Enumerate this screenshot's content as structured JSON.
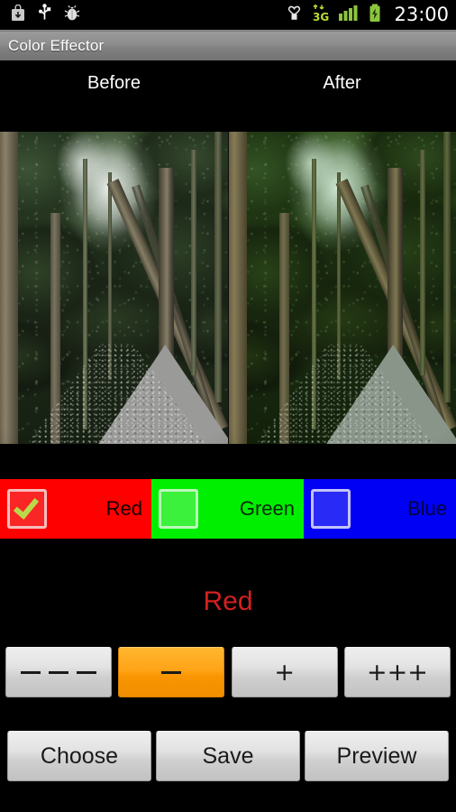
{
  "statusbar": {
    "icons_left": [
      {
        "name": "download-icon",
        "glyph": "⤓"
      },
      {
        "name": "usb-icon",
        "glyph": "ψ"
      },
      {
        "name": "adb-debug-icon",
        "glyph": "🐞"
      }
    ],
    "icons_right": [
      {
        "name": "alarm-or-vibrate-icon",
        "glyph": "♡"
      },
      {
        "name": "network-3g-icon",
        "label": "3G"
      },
      {
        "name": "signal-bars-icon",
        "bars": 4
      },
      {
        "name": "battery-charging-icon",
        "glyph": "⚡"
      }
    ],
    "clock": "23:00"
  },
  "titlebar": {
    "title": "Color Effector"
  },
  "preview": {
    "before_label": "Before",
    "after_label": "After",
    "before_alt": "forest path photo, original",
    "after_alt": "forest path photo, green tinted"
  },
  "channels": [
    {
      "name": "red",
      "label": "Red",
      "checked": true,
      "color": "#ff0000",
      "text_color": "#120000"
    },
    {
      "name": "green",
      "label": "Green",
      "checked": false,
      "color": "#00ee00",
      "text_color": "#062906"
    },
    {
      "name": "blue",
      "label": "Blue",
      "checked": false,
      "color": "#0000f5",
      "text_color": "#04043a"
    }
  ],
  "current_channel": {
    "label": "Red",
    "color": "#d42020"
  },
  "adjust_buttons": [
    {
      "name": "decrease-large",
      "label": "– – –",
      "glyph": "dashes3",
      "active": false
    },
    {
      "name": "decrease-small",
      "label": "–",
      "glyph": "dash1",
      "active": true
    },
    {
      "name": "increase-small",
      "label": "+",
      "glyph": "plus1",
      "active": false
    },
    {
      "name": "increase-large",
      "label": "+++",
      "glyph": "plus3",
      "active": false
    }
  ],
  "actions": [
    {
      "name": "choose",
      "label": "Choose"
    },
    {
      "name": "save",
      "label": "Save"
    },
    {
      "name": "preview",
      "label": "Preview"
    }
  ]
}
